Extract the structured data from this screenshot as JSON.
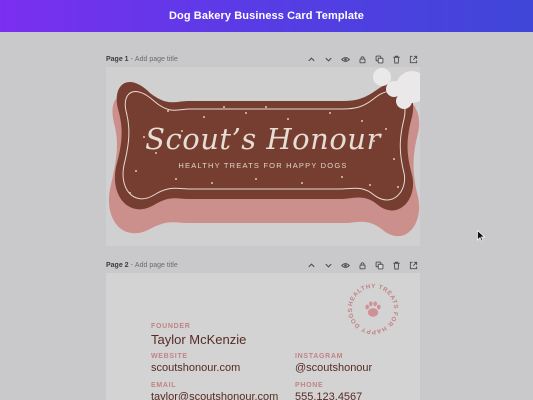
{
  "app": {
    "title": "Dog Bakery Business Card Template"
  },
  "pages": [
    {
      "name": "Page 1",
      "separator": "-",
      "title_placeholder": "Add page title"
    },
    {
      "name": "Page 2",
      "separator": "-",
      "title_placeholder": "Add page title"
    }
  ],
  "page_tools": [
    "chevron-up-icon",
    "chevron-down-icon",
    "eye-icon",
    "lock-icon",
    "duplicate-icon",
    "trash-icon",
    "add-page-icon"
  ],
  "card_front": {
    "brand_name": "Scout’s Honour",
    "tagline": "HEALTHY TREATS FOR HAPPY DOGS"
  },
  "card_back": {
    "founder_label": "FOUNDER",
    "founder_name": "Taylor McKenzie",
    "website_label": "WEBSITE",
    "website": "scoutshonour.com",
    "instagram_label": "INSTAGRAM",
    "instagram": "@scoutshonour",
    "email_label": "EMAIL",
    "email": "taylor@scoutshonour.com",
    "phone_label": "PHONE",
    "phone": "555.123.4567",
    "badge_text": "HEALTHY TREATS FOR HAPPY DOGS"
  },
  "colors": {
    "accent_gradient_start": "#7b2ff0",
    "accent_gradient_end": "#3f46d8",
    "bone_brown": "#7a3e30",
    "bone_pink": "#d49590",
    "label_pink": "#c98788",
    "text_brown": "#5a2a22"
  }
}
